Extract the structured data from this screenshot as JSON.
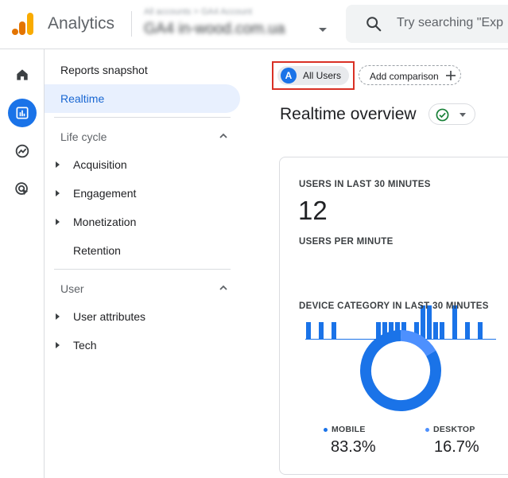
{
  "header": {
    "app_title": "Analytics",
    "account_line1": "All accounts > GA4 Account",
    "account_line2": "GA4 in-wood.com.ua",
    "search_placeholder": "Try searching \"Exp"
  },
  "nav": {
    "items": [
      {
        "label": "Reports snapshot"
      },
      {
        "label": "Realtime"
      }
    ],
    "lifecycle": {
      "title": "Life cycle",
      "items": [
        {
          "label": "Acquisition"
        },
        {
          "label": "Engagement"
        },
        {
          "label": "Monetization"
        },
        {
          "label": "Retention"
        }
      ]
    },
    "user": {
      "title": "User",
      "items": [
        {
          "label": "User attributes"
        },
        {
          "label": "Tech"
        }
      ]
    }
  },
  "comparison": {
    "all_users_avatar": "A",
    "all_users_label": "All Users",
    "add_label": "Add comparison"
  },
  "page": {
    "title": "Realtime overview"
  },
  "card": {
    "users_label": "USERS IN LAST 30 MINUTES",
    "users_value": "12",
    "per_minute_label": "USERS PER MINUTE",
    "device_label": "DEVICE CATEGORY IN LAST 30 MINUTES",
    "mobile_label": "MOBILE",
    "mobile_value": "83.3%",
    "desktop_label": "DESKTOP",
    "desktop_value": "16.7%"
  },
  "chart_data": [
    {
      "type": "bar",
      "title": "USERS PER MINUTE",
      "values": [
        1,
        0,
        1,
        0,
        1,
        0,
        0,
        0,
        0,
        0,
        0,
        1,
        1,
        1,
        1,
        1,
        0,
        1,
        2,
        2,
        1,
        1,
        0,
        2,
        0,
        1,
        0,
        1,
        0,
        0
      ],
      "ylim": [
        0,
        2
      ],
      "grid": false
    },
    {
      "type": "pie",
      "title": "DEVICE CATEGORY IN LAST 30 MINUTES",
      "categories": [
        "MOBILE",
        "DESKTOP"
      ],
      "values": [
        83.3,
        16.7
      ]
    }
  ],
  "colors": {
    "primary": "#1a73e8",
    "bar": "#1a73e8",
    "desktop": "#4d90fe",
    "highlight": "#d93025",
    "success": "#188038"
  }
}
